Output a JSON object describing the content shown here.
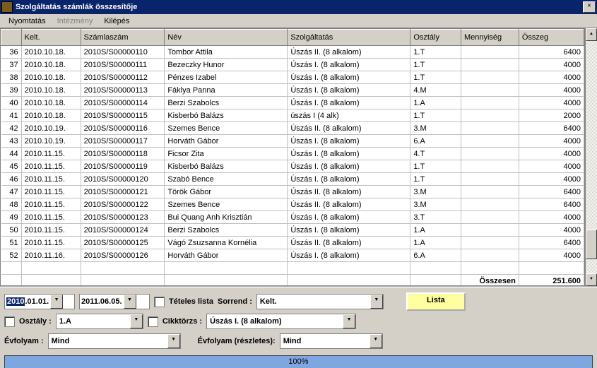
{
  "window": {
    "title": "Szolgáltatás számlák összesítője",
    "close": "×"
  },
  "menu": {
    "nyomtatas": "Nyomtatás",
    "intezmeny": "Intézmény",
    "kilepes": "Kilépés"
  },
  "grid": {
    "headers": {
      "rownum": "",
      "kelt": "Kelt.",
      "szamlaszam": "Számlaszám",
      "nev": "Név",
      "szolgaltatas": "Szolgáltatás",
      "osztaly": "Osztály",
      "mennyiseg": "Mennyiség",
      "osszeg": "Összeg"
    },
    "rows": [
      {
        "n": "36",
        "kelt": "2010.10.18.",
        "szam": "2010S/S00000110",
        "nev": "Tombor Attila",
        "szolg": "Úszás II. (8 alkalom)",
        "oszt": "1.T",
        "menny": "",
        "ossz": "6400"
      },
      {
        "n": "37",
        "kelt": "2010.10.18.",
        "szam": "2010S/S00000111",
        "nev": "Bezeczky Hunor",
        "szolg": "Úszás I. (8 alkalom)",
        "oszt": "1.T",
        "menny": "",
        "ossz": "4000"
      },
      {
        "n": "38",
        "kelt": "2010.10.18.",
        "szam": "2010S/S00000112",
        "nev": "Pénzes Izabel",
        "szolg": "Úszás I. (8 alkalom)",
        "oszt": "1.T",
        "menny": "",
        "ossz": "4000"
      },
      {
        "n": "39",
        "kelt": "2010.10.18.",
        "szam": "2010S/S00000113",
        "nev": "Fáklya Panna",
        "szolg": "Úszás I. (8 alkalom)",
        "oszt": "4.M",
        "menny": "",
        "ossz": "4000"
      },
      {
        "n": "40",
        "kelt": "2010.10.18.",
        "szam": "2010S/S00000114",
        "nev": "Berzi Szabolcs",
        "szolg": "Úszás I. (8 alkalom)",
        "oszt": "1.A",
        "menny": "",
        "ossz": "4000"
      },
      {
        "n": "41",
        "kelt": "2010.10.18.",
        "szam": "2010S/S00000115",
        "nev": "Kisberbó Balázs",
        "szolg": "úszás  I  (4 alk)",
        "oszt": "1.T",
        "menny": "",
        "ossz": "2000"
      },
      {
        "n": "42",
        "kelt": "2010.10.19.",
        "szam": "2010S/S00000116",
        "nev": "Szemes Bence",
        "szolg": "Úszás II. (8 alkalom)",
        "oszt": "3.M",
        "menny": "",
        "ossz": "6400"
      },
      {
        "n": "43",
        "kelt": "2010.10.19.",
        "szam": "2010S/S00000117",
        "nev": "Horváth Gábor",
        "szolg": "Úszás I. (8 alkalom)",
        "oszt": "6.A",
        "menny": "",
        "ossz": "4000"
      },
      {
        "n": "44",
        "kelt": "2010.11.15.",
        "szam": "2010S/S00000118",
        "nev": "Ficsor Zita",
        "szolg": "Úszás I. (8 alkalom)",
        "oszt": "4.T",
        "menny": "",
        "ossz": "4000"
      },
      {
        "n": "45",
        "kelt": "2010.11.15.",
        "szam": "2010S/S00000119",
        "nev": "Kisberbó Balázs",
        "szolg": "Úszás I. (8 alkalom)",
        "oszt": "1.T",
        "menny": "",
        "ossz": "4000"
      },
      {
        "n": "46",
        "kelt": "2010.11.15.",
        "szam": "2010S/S00000120",
        "nev": "Szabó Bence",
        "szolg": "Úszás I. (8 alkalom)",
        "oszt": "1.T",
        "menny": "",
        "ossz": "4000"
      },
      {
        "n": "47",
        "kelt": "2010.11.15.",
        "szam": "2010S/S00000121",
        "nev": "Török Gábor",
        "szolg": "Úszás II. (8 alkalom)",
        "oszt": "3.M",
        "menny": "",
        "ossz": "6400"
      },
      {
        "n": "48",
        "kelt": "2010.11.15.",
        "szam": "2010S/S00000122",
        "nev": "Szemes Bence",
        "szolg": "Úszás II. (8 alkalom)",
        "oszt": "3.M",
        "menny": "",
        "ossz": "6400"
      },
      {
        "n": "49",
        "kelt": "2010.11.15.",
        "szam": "2010S/S00000123",
        "nev": "Bui Quang Anh Krisztián",
        "szolg": "Úszás I. (8 alkalom)",
        "oszt": "3.T",
        "menny": "",
        "ossz": "4000"
      },
      {
        "n": "50",
        "kelt": "2010.11.15.",
        "szam": "2010S/S00000124",
        "nev": "Berzi Szabolcs",
        "szolg": "Úszás I. (8 alkalom)",
        "oszt": "1.A",
        "menny": "",
        "ossz": "4000"
      },
      {
        "n": "51",
        "kelt": "2010.11.15.",
        "szam": "2010S/S00000125",
        "nev": "Vágó Zsuzsanna Kornélia",
        "szolg": "Úszás II. (8 alkalom)",
        "oszt": "1.A",
        "menny": "",
        "ossz": "6400"
      },
      {
        "n": "52",
        "kelt": "2010.11.16.",
        "szam": "2010S/S00000126",
        "nev": "Horváth Gábor",
        "szolg": "Úszás I. (8 alkalom)",
        "oszt": "6.A",
        "menny": "",
        "ossz": "4000"
      }
    ],
    "footer": {
      "label": "Összesen",
      "total": "251.600"
    }
  },
  "controls": {
    "date_from_sel": "2010",
    "date_from_rest": ".01.01.",
    "date_to": "2011.06.05.",
    "teteles_lista": "Tételes lista",
    "sorrend_label": "Sorrend :",
    "sorrend_value": "Kelt.",
    "lista_btn": "Lista",
    "osztaly_label": "Osztály :",
    "osztaly_value": "1.A",
    "cikktorzs_label": "Cikktörzs :",
    "cikktorzs_value": "Úszás I. (8 alkalom)",
    "evfolyam_label": "Évfolyam :",
    "evfolyam_value": "Mind",
    "evfolyam_reszletes_label": "Évfolyam (részletes):",
    "evfolyam_reszletes_value": "Mind"
  },
  "progress": {
    "text": "100%"
  }
}
